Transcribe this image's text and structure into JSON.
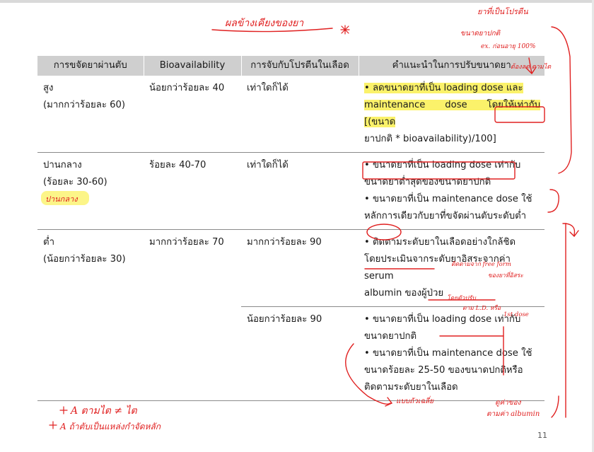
{
  "table": {
    "headers": [
      "การขจัดยาผ่านตับ",
      "Bioavailability",
      "การจับกับโปรตีนในเลือด",
      "คำแนะนำในการปรับขนาดยา"
    ],
    "rows": [
      {
        "clearance": [
          "สูง",
          "(มากกว่าร้อยละ 60)"
        ],
        "bioavailability": "น้อยกว่าร้อยละ 40",
        "protein_binding": "เท่าใดก็ได้",
        "recommendation": [
          "• ลดขนาดยาที่เป็น loading dose และ",
          "maintenance dose โดยให้เท่ากับ [(ขนาด",
          "ยาปกติ * bioavailability)/100]"
        ]
      },
      {
        "clearance": [
          "ปานกลาง",
          "(ร้อยละ 30-60)"
        ],
        "bioavailability": "ร้อยละ 40-70",
        "protein_binding": "เท่าใดก็ได้",
        "recommendation": [
          "• ขนาดยาที่เป็น loading dose เท่ากับ",
          "ขนาดยาต่ำสุดของขนาดยาปกติ",
          "• ขนาดยาที่เป็น maintenance dose ใช้",
          "หลักการเดียวกับยาที่ขจัดผ่านตับระดับต่ำ"
        ]
      },
      {
        "clearance": [
          "ต่ำ",
          "(น้อยกว่าร้อยละ 30)"
        ],
        "bioavailability": "มากกว่าร้อยละ 70",
        "protein_binding": "มากกว่าร้อยละ 90",
        "recommendation": [
          "• ติดตามระดับยาในเลือดอย่างใกล้ชิด",
          "โดยประเมินจากระดับยาอิสระจากค่า serum",
          "albumin ของผู้ป่วย"
        ]
      },
      {
        "protein_binding": "น้อยกว่าร้อยละ 90",
        "recommendation": [
          "• ขนาดยาที่เป็น loading dose เท่ากับ",
          "ขนาดยาปกติ",
          "• ขนาดยาที่เป็น maintenance dose ใช้",
          "ขนาดร้อยละ 25-50 ของขนาดปกติหรือ",
          "ติดตามระดับยาในเลือด"
        ]
      }
    ]
  },
  "annotations": {
    "top_center": "ผลข้างเคียงของยา",
    "top_right_1": "ยาที่เป็นโปรตีน",
    "top_right_2": "ขนาดยาปกติ",
    "top_right_3": "ex. ก่อนอายุ 100%",
    "header_side": "ต้องลด ตามไต",
    "row2_yellow": "ปานกลาง",
    "row3_note": "ติดตามจาก free form",
    "row3_note2": "ของยาที่อิสระ",
    "row4_note1": "โดยตัวปรับ",
    "row4_note2": "ตาม L.D. หรือ",
    "row4_note3": "1st dose",
    "bottom_center": "แบบถัวเฉลี่ย",
    "bottom_right_1": "ดูค่าของ",
    "bottom_right_2": "ตามค่า albumin",
    "bottom_left_1": "A ตามไต ≠ ไต",
    "bottom_left_2": "A ถ้าตับเป็นแหล่งกำจัดหลัก"
  },
  "page_number": "11",
  "colors": {
    "ink": "#e02020",
    "highlight": "#fbf26a",
    "header_bg": "#cfcfcf"
  }
}
